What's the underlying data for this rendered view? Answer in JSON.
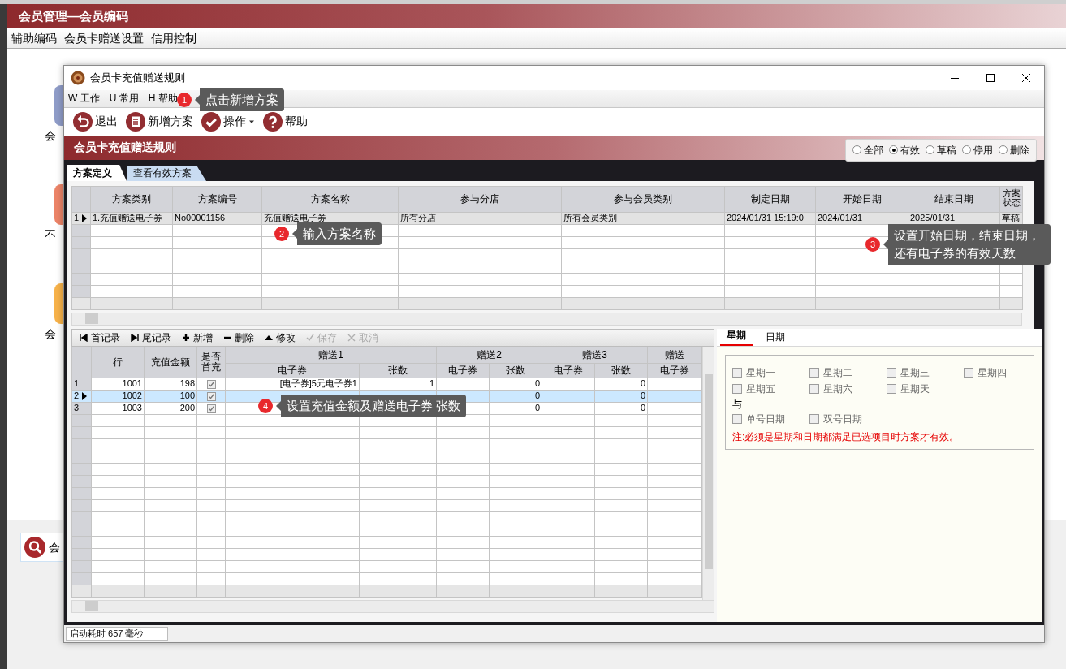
{
  "main_window": {
    "title": "会员管理—会员编码",
    "menu": [
      {
        "label": "辅助编码"
      },
      {
        "label": "会员卡赠送设置"
      },
      {
        "label": "信用控制"
      }
    ],
    "tiles": [
      {
        "label": "会",
        "color": "#8f9cc8"
      },
      {
        "label": "不",
        "color": "#ec8468"
      },
      {
        "label": "会",
        "color": "#f7b24a"
      }
    ],
    "search": {
      "label": "会"
    }
  },
  "dialog": {
    "title": "会员卡充值赠送规则",
    "menu": [
      {
        "key": "W",
        "label": "工作"
      },
      {
        "key": "U",
        "label": "常用"
      },
      {
        "key": "H",
        "label": "帮助"
      }
    ],
    "toolbar": [
      {
        "label": "退出",
        "kind": "undo",
        "dropdown": false
      },
      {
        "label": "新增方案",
        "kind": "list",
        "dropdown": false
      },
      {
        "label": "操作",
        "kind": "check",
        "dropdown": true
      },
      {
        "label": "帮助",
        "kind": "help",
        "dropdown": false
      }
    ],
    "banner": "会员卡充值赠送规则",
    "status_filter": [
      {
        "label": "全部",
        "selected": false
      },
      {
        "label": "有效",
        "selected": true
      },
      {
        "label": "草稿",
        "selected": false
      },
      {
        "label": "停用",
        "selected": false
      },
      {
        "label": "删除",
        "selected": false
      }
    ],
    "tabs": [
      {
        "label": "方案定义",
        "selected": true
      },
      {
        "label": "查看有效方案",
        "selected": false
      }
    ],
    "plans_table": {
      "columns": [
        "方案类别",
        "方案编号",
        "方案名称",
        "参与分店",
        "参与会员类别",
        "制定日期",
        "开始日期",
        "结束日期",
        "方案状态"
      ],
      "rows": [
        {
          "number": "1",
          "selected": true,
          "cells": [
            "1.充值赠送电子券",
            "No00001156",
            "充值赠送电子券",
            "所有分店",
            "所有会员类别",
            "2024/01/31 15:19:0",
            "2024/01/31",
            "2025/01/31",
            "草稿"
          ]
        }
      ]
    },
    "detail_toolbar": [
      {
        "label": "首记录",
        "kind": "first",
        "disabled": false
      },
      {
        "label": "尾记录",
        "kind": "last",
        "disabled": false
      },
      {
        "label": "新增",
        "kind": "plus",
        "disabled": false
      },
      {
        "label": "删除",
        "kind": "minus",
        "disabled": false
      },
      {
        "label": "修改",
        "kind": "up",
        "disabled": false
      },
      {
        "label": "保存",
        "kind": "tick",
        "disabled": true
      },
      {
        "label": "取消",
        "kind": "cross",
        "disabled": true
      }
    ],
    "detail_table": {
      "columns": [
        "行",
        "充值金额",
        "是否首充"
      ],
      "groups": [
        {
          "label": "赠送1",
          "columns": [
            "电子券",
            "张数"
          ]
        },
        {
          "label": "赠送2",
          "columns": [
            "电子券",
            "张数"
          ]
        },
        {
          "label": "赠送3",
          "columns": [
            "电子券",
            "张数"
          ]
        },
        {
          "label": "赠送",
          "columns": [
            "电子券"
          ]
        }
      ],
      "rows": [
        {
          "number": "1",
          "selected": false,
          "cells": [
            "1001",
            "198"
          ],
          "first_charge": true,
          "gift1": {
            "coupon": "[电子券]5元电子券1",
            "count": "1"
          },
          "gift2": {
            "count": "0"
          },
          "gift3": {
            "count": "0"
          }
        },
        {
          "number": "2",
          "selected": true,
          "cells": [
            "1002",
            "100"
          ],
          "first_charge": true,
          "gift2": {
            "count": "0"
          },
          "gift3": {
            "count": "0"
          }
        },
        {
          "number": "3",
          "selected": false,
          "cells": [
            "1003",
            "200"
          ],
          "first_charge": true,
          "gift2": {
            "count": "0"
          },
          "gift3": {
            "count": "0"
          }
        }
      ]
    },
    "schedule": {
      "tabs": [
        {
          "label": "星期",
          "selected": true
        },
        {
          "label": "日期",
          "selected": false
        }
      ],
      "weekdays": [
        {
          "label": "星期一",
          "checked": false,
          "disabled": true
        },
        {
          "label": "星期二",
          "checked": false,
          "disabled": true
        },
        {
          "label": "星期三",
          "checked": false,
          "disabled": true
        },
        {
          "label": "星期四",
          "checked": false,
          "disabled": true
        },
        {
          "label": "星期五",
          "checked": false,
          "disabled": true
        },
        {
          "label": "星期六",
          "checked": false,
          "disabled": true
        },
        {
          "label": "星期天",
          "checked": false,
          "disabled": true
        }
      ],
      "separator": "与",
      "date_options": [
        {
          "label": "单号日期",
          "checked": false,
          "disabled": true
        },
        {
          "label": "双号日期",
          "checked": false,
          "disabled": true
        }
      ],
      "note": "注:必须是星期和日期都满足已选项目时方案才有效。"
    },
    "status_bar": "启动耗时 657 毫秒"
  },
  "callouts": [
    {
      "number": "1",
      "text": "点击新增方案"
    },
    {
      "number": "2",
      "text": "输入方案名称"
    },
    {
      "number": "3",
      "text": "设置开始日期，结束日期，还有电子券的有效天数"
    },
    {
      "number": "4",
      "text": "设置充值金额及赠送电子券 张数"
    }
  ]
}
